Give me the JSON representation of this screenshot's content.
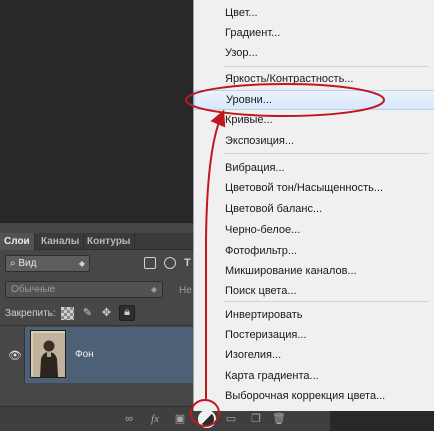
{
  "layers_panel": {
    "tabs": [
      "Слои",
      "Каналы",
      "Контуры"
    ],
    "filter": {
      "value": "Вид",
      "icon": "search-icon"
    },
    "blend_mode": {
      "value": "Обычные"
    },
    "opacity_label": "Не",
    "lock_label": "Закрепить:",
    "layer": {
      "name": "Фон"
    }
  },
  "adjustment_menu": {
    "items": [
      "Цвет...",
      "Градиент...",
      "Узор...",
      "Яркость/Контрастность...",
      "Уровни...",
      "Кривые...",
      "Экспозиция...",
      "Вибрация...",
      "Цветовой тон/Насыщенность...",
      "Цветовой баланс...",
      "Черно-белое...",
      "Фотофильтр...",
      "Микширование каналов...",
      "Поиск цвета...",
      "Инвертировать",
      "Постеризация...",
      "Изогелия...",
      "Карта градиента...",
      "Выборочная коррекция цвета..."
    ],
    "highlighted": "Уровни..."
  },
  "colors": {
    "annotation": "#c0181e",
    "selected_layer": "#4d6176",
    "menu_background": "#f0f0f0"
  }
}
